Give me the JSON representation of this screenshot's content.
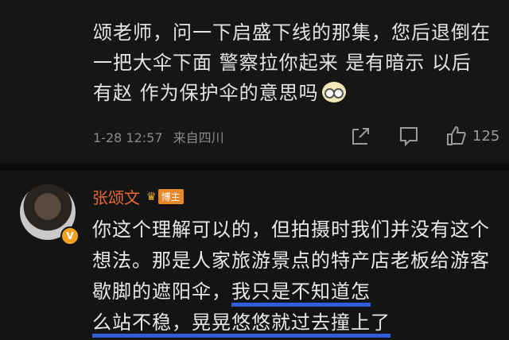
{
  "comment1": {
    "text": "颂老师，问一下启盛下线的那集，您后退倒在一把大伞下面 警察拉你起来 是有暗示 以后有赵 作为保护伞的意思吗",
    "time": "1-28 12:57",
    "location": "来自四川",
    "like_count": "125"
  },
  "comment2": {
    "username": "张颂文",
    "badge": "博主",
    "text_plain": "你这个理解可以的，但拍摄时我们并没有这个想法。那是人家旅游景点的特产店老板给游客歇脚的遮阳伞，",
    "text_highlight_1": "我只是不知道怎",
    "text_highlight_2": "么站不稳，晃晃悠悠就过去撞上了",
    "verified_mark": "V"
  },
  "icons": [
    "share-icon",
    "reply-icon",
    "like-icon",
    "emoji-icon",
    "crown-icon"
  ],
  "colors": {
    "username": "#e96a2f",
    "highlight": "#2f60dc",
    "background": "#141414"
  }
}
